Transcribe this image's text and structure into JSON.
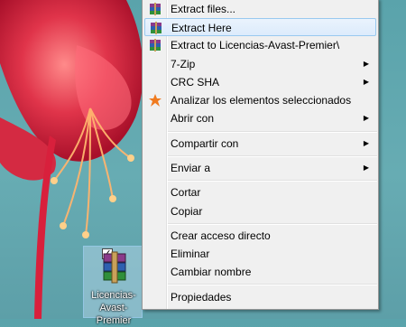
{
  "desktop": {
    "file_label": "Licencias-Avast-\nPremier",
    "checkbox": "✓"
  },
  "context_menu": {
    "items": [
      {
        "label": "Extract files...",
        "icon": "winrar-icon",
        "has_submenu": false
      },
      {
        "label": "Extract Here",
        "icon": "winrar-icon",
        "has_submenu": false,
        "highlighted": true
      },
      {
        "label": "Extract to Licencias-Avast-Premier\\",
        "icon": "winrar-icon",
        "has_submenu": false
      },
      {
        "label": "7-Zip",
        "has_submenu": true
      },
      {
        "label": "CRC SHA",
        "has_submenu": true
      },
      {
        "label": "Analizar los elementos seleccionados",
        "icon": "avast-icon",
        "has_submenu": false
      },
      {
        "label": "Abrir con",
        "has_submenu": true
      },
      {
        "label": "Compartir con",
        "has_submenu": true
      },
      {
        "label": "Enviar a",
        "has_submenu": true
      },
      {
        "label": "Cortar",
        "has_submenu": false
      },
      {
        "label": "Copiar",
        "has_submenu": false
      },
      {
        "label": "Crear acceso directo",
        "has_submenu": false
      },
      {
        "label": "Eliminar",
        "has_submenu": false
      },
      {
        "label": "Cambiar nombre",
        "has_submenu": false
      },
      {
        "label": "Propiedades",
        "has_submenu": false
      }
    ],
    "submenu_arrow": "▶",
    "highlight_color": "#dcebfc",
    "avast_color": "#f07a1f"
  }
}
